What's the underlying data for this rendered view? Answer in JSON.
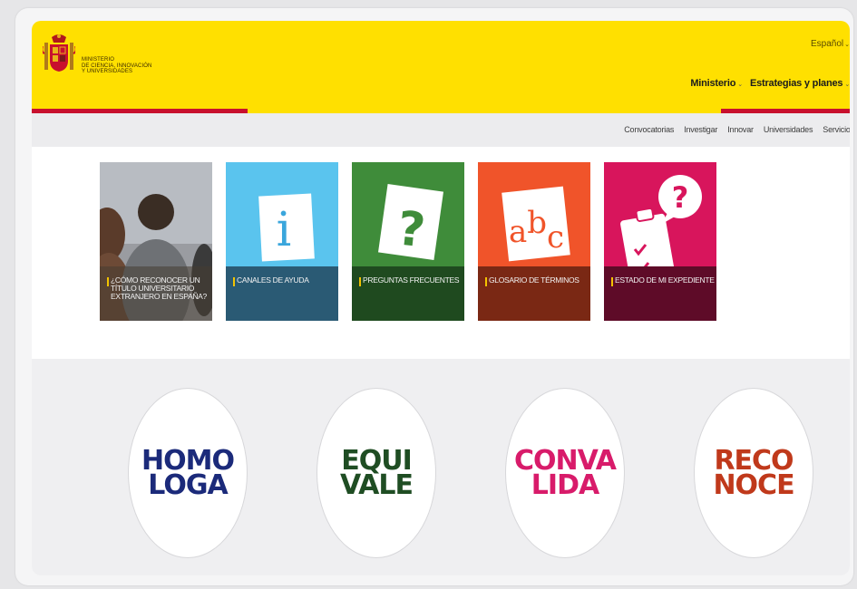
{
  "header": {
    "ministry_lines": [
      "MINISTERIO",
      "DE CIENCIA, INNOVACIÓN",
      "Y UNIVERSIDADES"
    ],
    "language": "Español",
    "nav": [
      {
        "label": "Ministerio"
      },
      {
        "label": "Estrategias y planes"
      }
    ]
  },
  "subnav": [
    "Convocatorias",
    "Investigar",
    "Innovar",
    "Universidades",
    "Servicios"
  ],
  "tiles": [
    {
      "label": "¿CÓMO RECONOCER UN TÍTULO UNIVERSITARIO EXTRANJERO EN ESPAÑA?",
      "color": "#8d8f94"
    },
    {
      "label": "CANALES DE AYUDA",
      "color": "#5ac4ee"
    },
    {
      "label": "PREGUNTAS FRECUENTES",
      "color": "#3f8c3a"
    },
    {
      "label": "GLOSARIO DE TÉRMINOS",
      "color": "#f0542a"
    },
    {
      "label": "ESTADO DE MI EXPEDIENTE",
      "color": "#d8155c"
    }
  ],
  "ovals": [
    {
      "l1": "HOMO",
      "l2": "LOGA",
      "color": "#1b2a7a"
    },
    {
      "l1": "EQUI",
      "l2": "VALE",
      "color": "#1f4d23"
    },
    {
      "l1": "CONVA",
      "l2": "LIDA",
      "color": "#d81b6a"
    },
    {
      "l1": "RECO",
      "l2": "NOCE",
      "color": "#c0391b"
    }
  ],
  "icon_text": {
    "info": "i",
    "question": "?",
    "abc_a": "a",
    "abc_b": "b",
    "abc_c": "c"
  },
  "colors": {
    "header": "#ffe000",
    "accent_red": "#c8102e"
  }
}
